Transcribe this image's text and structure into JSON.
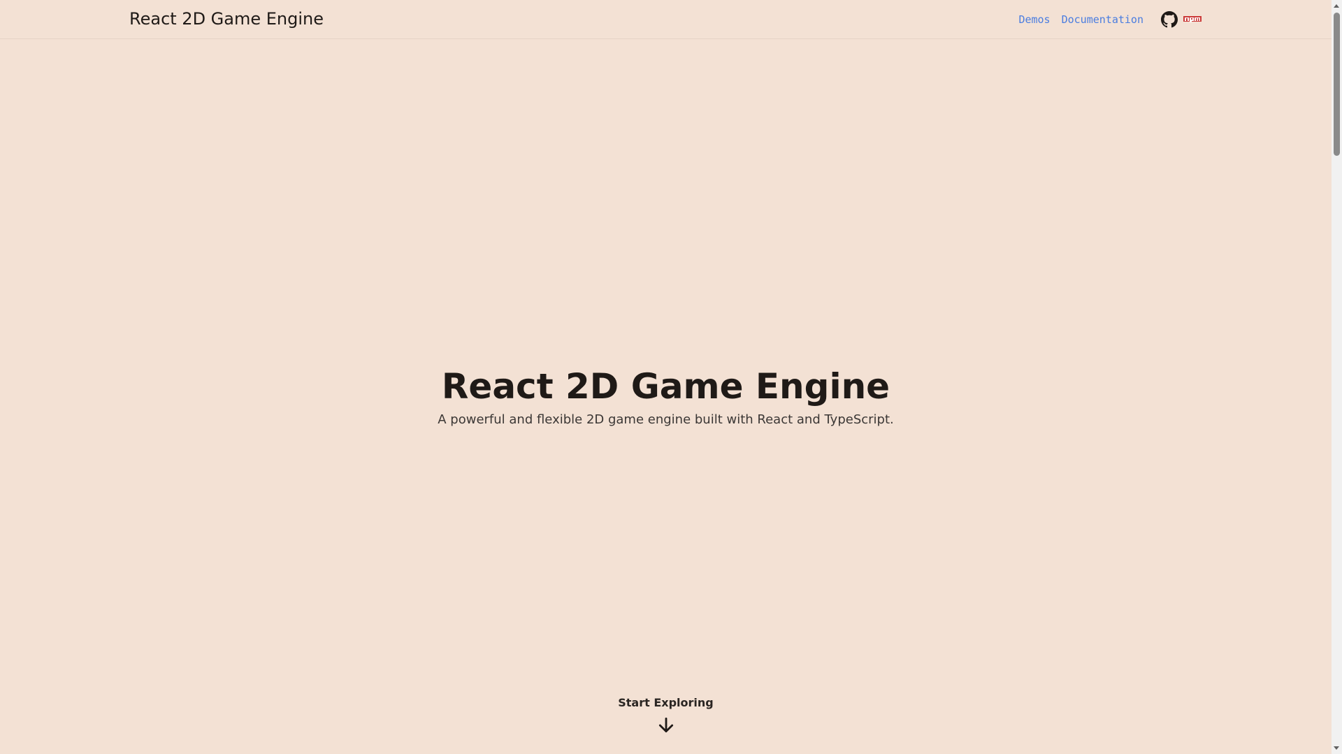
{
  "header": {
    "brand": "React 2D Game Engine",
    "nav": [
      {
        "label": "Demos"
      },
      {
        "label": "Documentation"
      }
    ],
    "icons": [
      {
        "name": "github-icon"
      },
      {
        "name": "npm-icon"
      }
    ]
  },
  "hero": {
    "title": "React 2D Game Engine",
    "subtitle": "A powerful and flexible 2D game engine built with React and TypeScript."
  },
  "explore": {
    "label": "Start Exploring",
    "icon": "arrow-down-icon"
  },
  "colors": {
    "background": "#f3e1d4",
    "link": "#4a7de0",
    "npm": "#cb3837",
    "text": "#1f1a17"
  }
}
